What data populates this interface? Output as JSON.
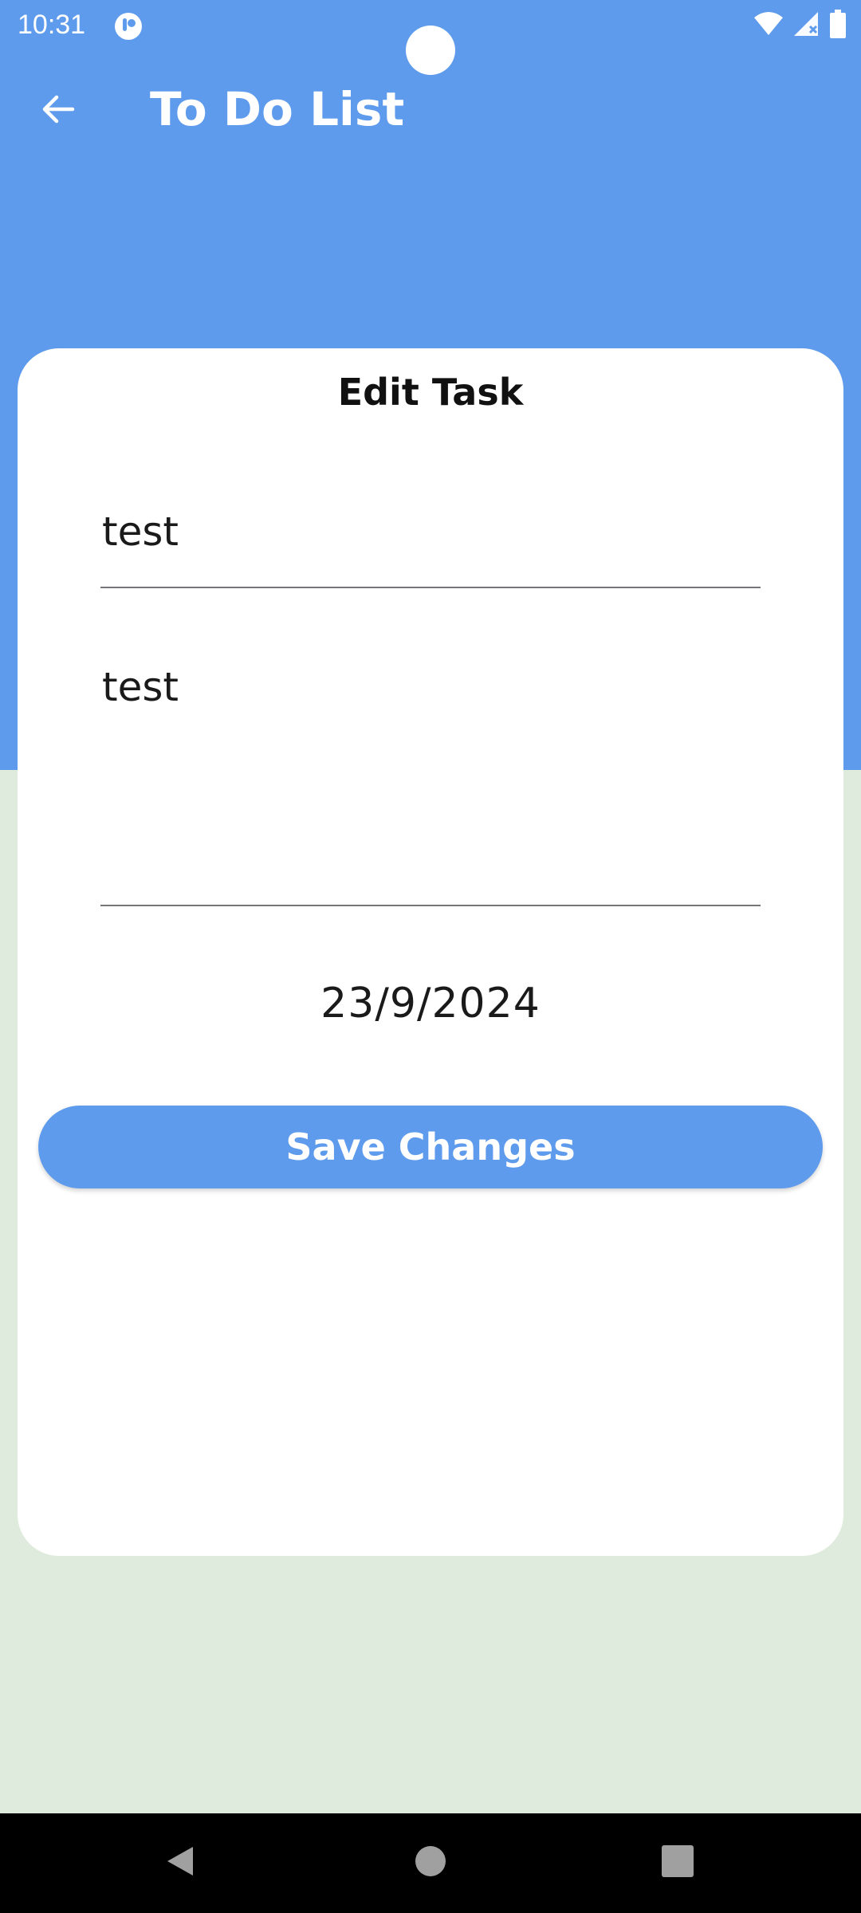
{
  "status_bar": {
    "time": "10:31",
    "icons": [
      "app-notification-icon",
      "wifi-icon",
      "signal-icon",
      "battery-icon"
    ]
  },
  "app_bar": {
    "title": "To Do List",
    "back_icon": "arrow-back-icon"
  },
  "edit_card": {
    "title": "Edit Task",
    "task_title_value": "test",
    "task_description_value": "test",
    "due_date": "23/9/2024",
    "save_label": "Save Changes"
  },
  "nav_bar": {
    "icons": [
      "back-triangle-icon",
      "home-circle-icon",
      "recents-square-icon"
    ]
  },
  "colors": {
    "primary": "#5E9BEC",
    "background": "#DFEBDC",
    "card": "#FFFFFF",
    "text": "#1A1A1A"
  }
}
